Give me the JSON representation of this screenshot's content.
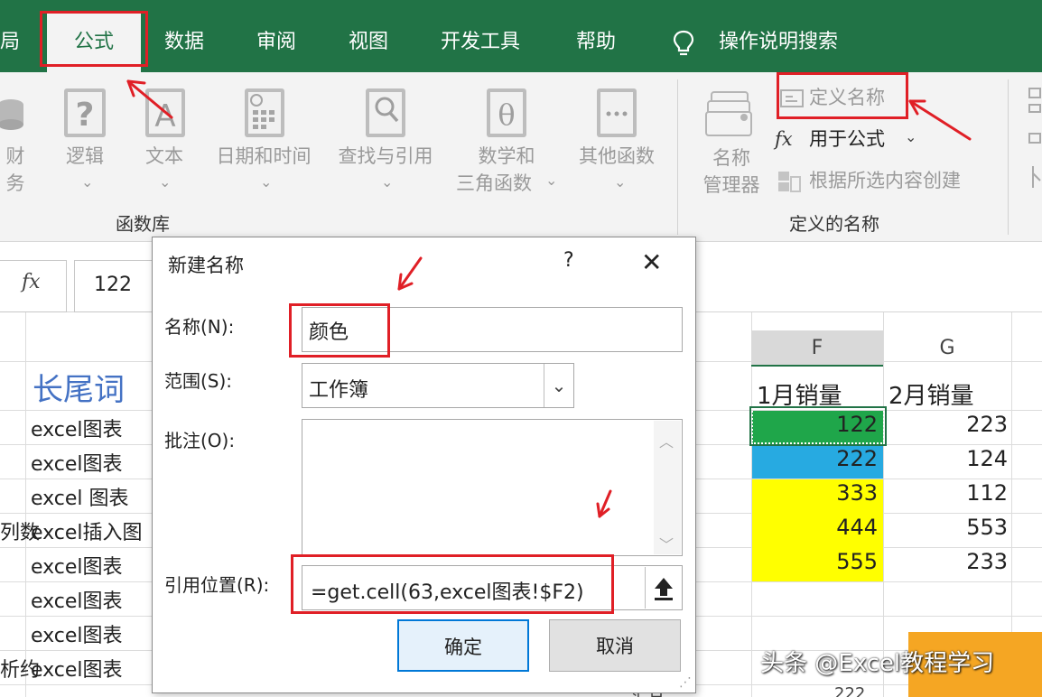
{
  "ribbon_tabs": {
    "layout_partial": "局",
    "formulas": "公式",
    "data": "数据",
    "review": "审阅",
    "view": "视图",
    "developer": "开发工具",
    "help": "帮助",
    "tell_me": "操作说明搜索"
  },
  "function_library": {
    "finance_partial": "财务",
    "logical": "逻辑",
    "text": "文本",
    "datetime": "日期和时间",
    "lookup": "查找与引用",
    "math_line1": "数学和",
    "math_line2": "三角函数",
    "more": "其他函数",
    "group_label": "函数库"
  },
  "defined_names": {
    "name_manager_line1": "名称",
    "name_manager_line2": "管理器",
    "define_name": "定义名称",
    "use_in_formula": "用于公式",
    "create_from_selection": "根据所选内容创建",
    "group_label": "定义的名称"
  },
  "formula_bar": {
    "fx": "fx",
    "value": "122"
  },
  "sheet": {
    "col_f": "F",
    "col_g": "G",
    "header_longtail": "长尾词",
    "rows": [
      "excel图表",
      "excel图表",
      "excel 图表",
      "excel插入图",
      "excel图表",
      "excel图表",
      "excel图表",
      "excel图表"
    ],
    "left_partial": [
      "",
      "",
      "",
      "列数",
      "",
      "",
      "",
      "析约"
    ],
    "f_header": "1月销量",
    "g_header": "2月销量",
    "f_values": [
      "122",
      "222",
      "333",
      "444",
      "555"
    ],
    "g_values": [
      "223",
      "124",
      "112",
      "553",
      "233"
    ],
    "bottom_partial_1": "汇总",
    "bottom_partial_2": "222",
    "fill_colors": [
      "#1fa64a",
      "#27aae1",
      "#ffff00",
      "#ffff00",
      "#ffff00"
    ]
  },
  "dialog": {
    "title": "新建名称",
    "help": "?",
    "close": "✕",
    "name_label": "名称(N):",
    "name_value": "颜色",
    "scope_label": "范围(S):",
    "scope_value": "工作簿",
    "comment_label": "批注(O):",
    "ref_label": "引用位置(R):",
    "ref_value": "=get.cell(63,excel图表!$F2)",
    "ok": "确定",
    "cancel": "取消"
  },
  "watermark": "头条 @Excel教程学习",
  "accent_color": "#217346",
  "highlight_color": "#e01f26"
}
